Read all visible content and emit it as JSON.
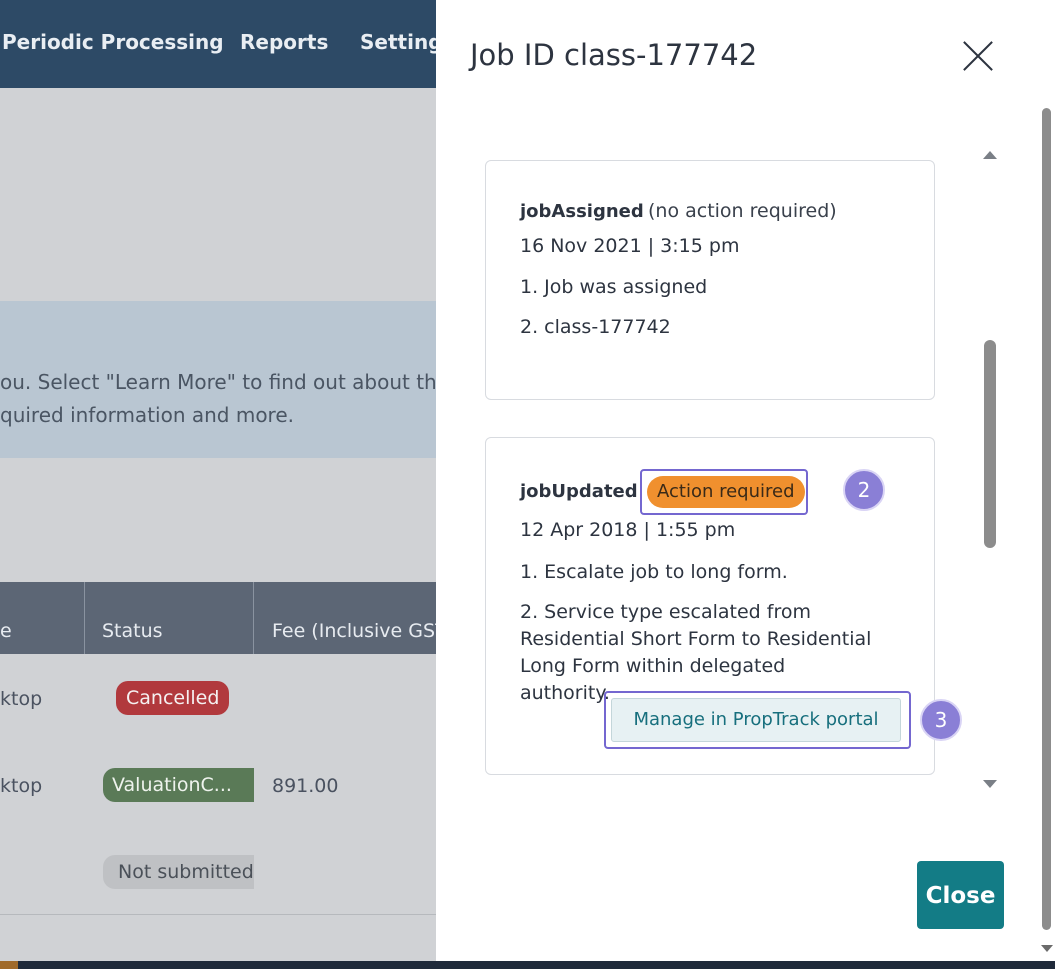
{
  "background": {
    "nav": {
      "items": [
        "Periodic Processing",
        "Reports",
        "Settings"
      ]
    },
    "banner": {
      "line1": "ou. Select \"Learn More\" to find out about th",
      "line2": "quired information and more."
    },
    "table": {
      "headers": [
        "e",
        "Status",
        "Fee (Inclusive GST"
      ],
      "rows": [
        {
          "type": "ktop",
          "status": "Cancelled",
          "fee": ""
        },
        {
          "type": "ktop",
          "status": "ValuationC...",
          "fee": "891.00"
        },
        {
          "type": "",
          "status": "Not submitted",
          "fee": ""
        }
      ]
    },
    "colors": {
      "nav": "#2d4a66",
      "cancelled": "#b1393d",
      "valuation": "#5a7a57"
    }
  },
  "modal": {
    "title": "Job ID class-177742",
    "events": [
      {
        "name": "jobAssigned",
        "note": "(no action required)",
        "date": "16 Nov 2021 | 3:15 pm",
        "lines": [
          "1. Job was assigned",
          "2. class-177742"
        ]
      },
      {
        "name": "jobUpdated",
        "badge": "Action required",
        "date": "12 Apr 2018 | 1:55 pm",
        "lines": [
          "1. Escalate job to long form.",
          "2. Service type escalated from Residential Short Form to Residential Long Form within delegated authority."
        ],
        "action_label": "Manage in PropTrack portal"
      }
    ],
    "steps": [
      "2",
      "3"
    ],
    "close_label": "Close",
    "colors": {
      "badge": "#f0902e",
      "close_button": "#137c86",
      "highlight": "#7467d0"
    }
  }
}
